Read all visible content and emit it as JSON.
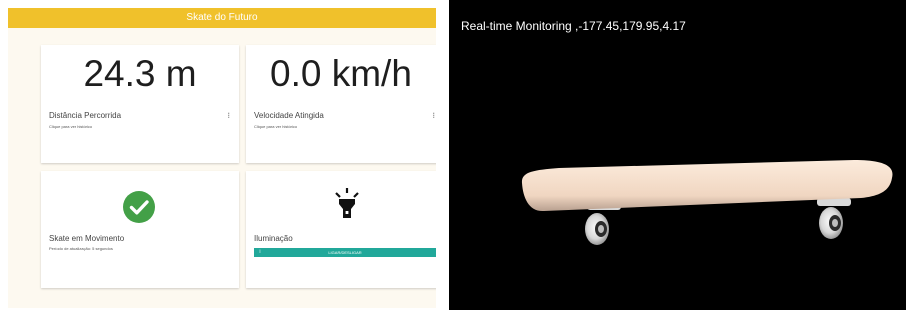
{
  "app": {
    "title": "Skate do Futuro"
  },
  "cards": {
    "distance": {
      "value": "24.3 m",
      "title": "Distância Percorrida",
      "subtitle": "Clique para ver histórico",
      "menu": "⁝"
    },
    "speed": {
      "value": "0.0 km/h",
      "title": "Velocidade Atingida",
      "subtitle": "Clique para ver histórico",
      "menu": "⁝"
    },
    "motion": {
      "title": "Skate em Movimento",
      "subtitle": "Período de atualização: 5 segundos",
      "icon": "check-circle-icon",
      "icon_color": "#43a047"
    },
    "lighting": {
      "title": "Iluminação",
      "icon": "flashlight-icon",
      "toggle_label": "LIGAR/DESLIGAR",
      "toggle_knob": "⏽",
      "toggle_color": "#21a89a"
    }
  },
  "viewer": {
    "label": "Real-time Monitoring ,-177.45,179.95,4.17"
  },
  "colors": {
    "appbar": "#f0c12b",
    "background": "#fdf9f0",
    "viewer_bg": "#000000"
  }
}
